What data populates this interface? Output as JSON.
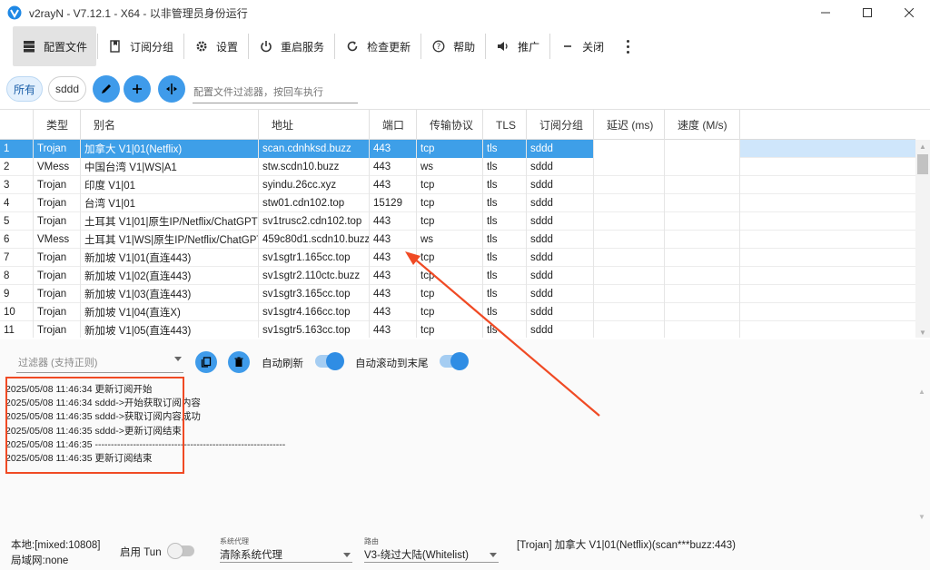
{
  "window": {
    "title": "v2rayN - V7.12.1 - X64 - 以非管理员身份运行"
  },
  "toolbar": {
    "items": [
      {
        "label": "配置文件",
        "icon": "server-icon",
        "active": true
      },
      {
        "label": "订阅分组",
        "icon": "subscription-icon"
      },
      {
        "label": "设置",
        "icon": "gear-icon"
      },
      {
        "label": "重启服务",
        "icon": "power-icon"
      },
      {
        "label": "检查更新",
        "icon": "refresh-icon"
      },
      {
        "label": "帮助",
        "icon": "help-icon"
      },
      {
        "label": "推广",
        "icon": "speaker-icon"
      },
      {
        "label": "关闭",
        "icon": "minus-icon"
      }
    ]
  },
  "filters": {
    "chip_all": "所有",
    "chip_sddd": "sddd",
    "filter_placeholder": "配置文件过滤器，按回车执行"
  },
  "grid": {
    "columns": [
      "",
      "类型",
      "别名",
      "地址",
      "端口",
      "传输协议",
      "TLS",
      "订阅分组",
      "延迟 (ms)",
      "速度 (M/s)"
    ],
    "rows": [
      [
        "1",
        "Trojan",
        "加拿大 V1|01(Netflix)",
        "scan.cdnhksd.buzz",
        "443",
        "tcp",
        "tls",
        "sddd"
      ],
      [
        "2",
        "VMess",
        "中国台湾 V1|WS|A1",
        "stw.scdn10.buzz",
        "443",
        "ws",
        "tls",
        "sddd"
      ],
      [
        "3",
        "Trojan",
        "印度 V1|01",
        "syindu.26cc.xyz",
        "443",
        "tcp",
        "tls",
        "sddd"
      ],
      [
        "4",
        "Trojan",
        "台湾 V1|01",
        "stw01.cdn102.top",
        "15129",
        "tcp",
        "tls",
        "sddd"
      ],
      [
        "5",
        "Trojan",
        "土耳其 V1|01|原生IP/Netflix/ChatGPT",
        "sv1trusc2.cdn102.top",
        "443",
        "tcp",
        "tls",
        "sddd"
      ],
      [
        "6",
        "VMess",
        "土耳其 V1|WS|原生IP/Netflix/ChatGPT",
        "459c80d1.scdn10.buzz",
        "443",
        "ws",
        "tls",
        "sddd"
      ],
      [
        "7",
        "Trojan",
        "新加坡 V1|01(直连443)",
        "sv1sgtr1.165cc.top",
        "443",
        "tcp",
        "tls",
        "sddd"
      ],
      [
        "8",
        "Trojan",
        "新加坡 V1|02(直连443)",
        "sv1sgtr2.110ctc.buzz",
        "443",
        "tcp",
        "tls",
        "sddd"
      ],
      [
        "9",
        "Trojan",
        "新加坡 V1|03(直连443)",
        "sv1sgtr3.165cc.top",
        "443",
        "tcp",
        "tls",
        "sddd"
      ],
      [
        "10",
        "Trojan",
        "新加坡 V1|04(直连X)",
        "sv1sgtr4.166cc.top",
        "443",
        "tcp",
        "tls",
        "sddd"
      ],
      [
        "11",
        "Trojan",
        "新加坡 V1|05(直连443)",
        "sv1sgtr5.163cc.top",
        "443",
        "tcp",
        "tls",
        "sddd"
      ]
    ]
  },
  "log": {
    "filter_placeholder": "过滤器 (支持正则)",
    "auto_refresh_label": "自动刷新",
    "auto_scroll_label": "自动滚动到末尾",
    "lines": [
      "2025/05/08 11:46:34 更新订阅开始",
      "2025/05/08 11:46:34 sddd->开始获取订阅内容",
      "2025/05/08 11:46:35 sddd->获取订阅内容成功",
      "2025/05/08 11:46:35 sddd->更新订阅结束",
      "2025/05/08 11:46:35 ------------------------------------------------------------",
      "2025/05/08 11:46:35 更新订阅结束"
    ]
  },
  "status": {
    "local": "本地:[mixed:10808]",
    "lan": "局域网:none",
    "tun_label": "启用 Tun",
    "sysproxy_caption": "系统代理",
    "sysproxy_value": "清除系统代理",
    "routing_caption": "路由",
    "routing_value": "V3-绕过大陆(Whitelist)",
    "current_server": "[Trojan] 加拿大 V1|01(Netflix)(scan***buzz:443)"
  },
  "colors": {
    "accent": "#3f9bea",
    "selection": "#cfe6fb",
    "annotation": "#f04a24"
  }
}
